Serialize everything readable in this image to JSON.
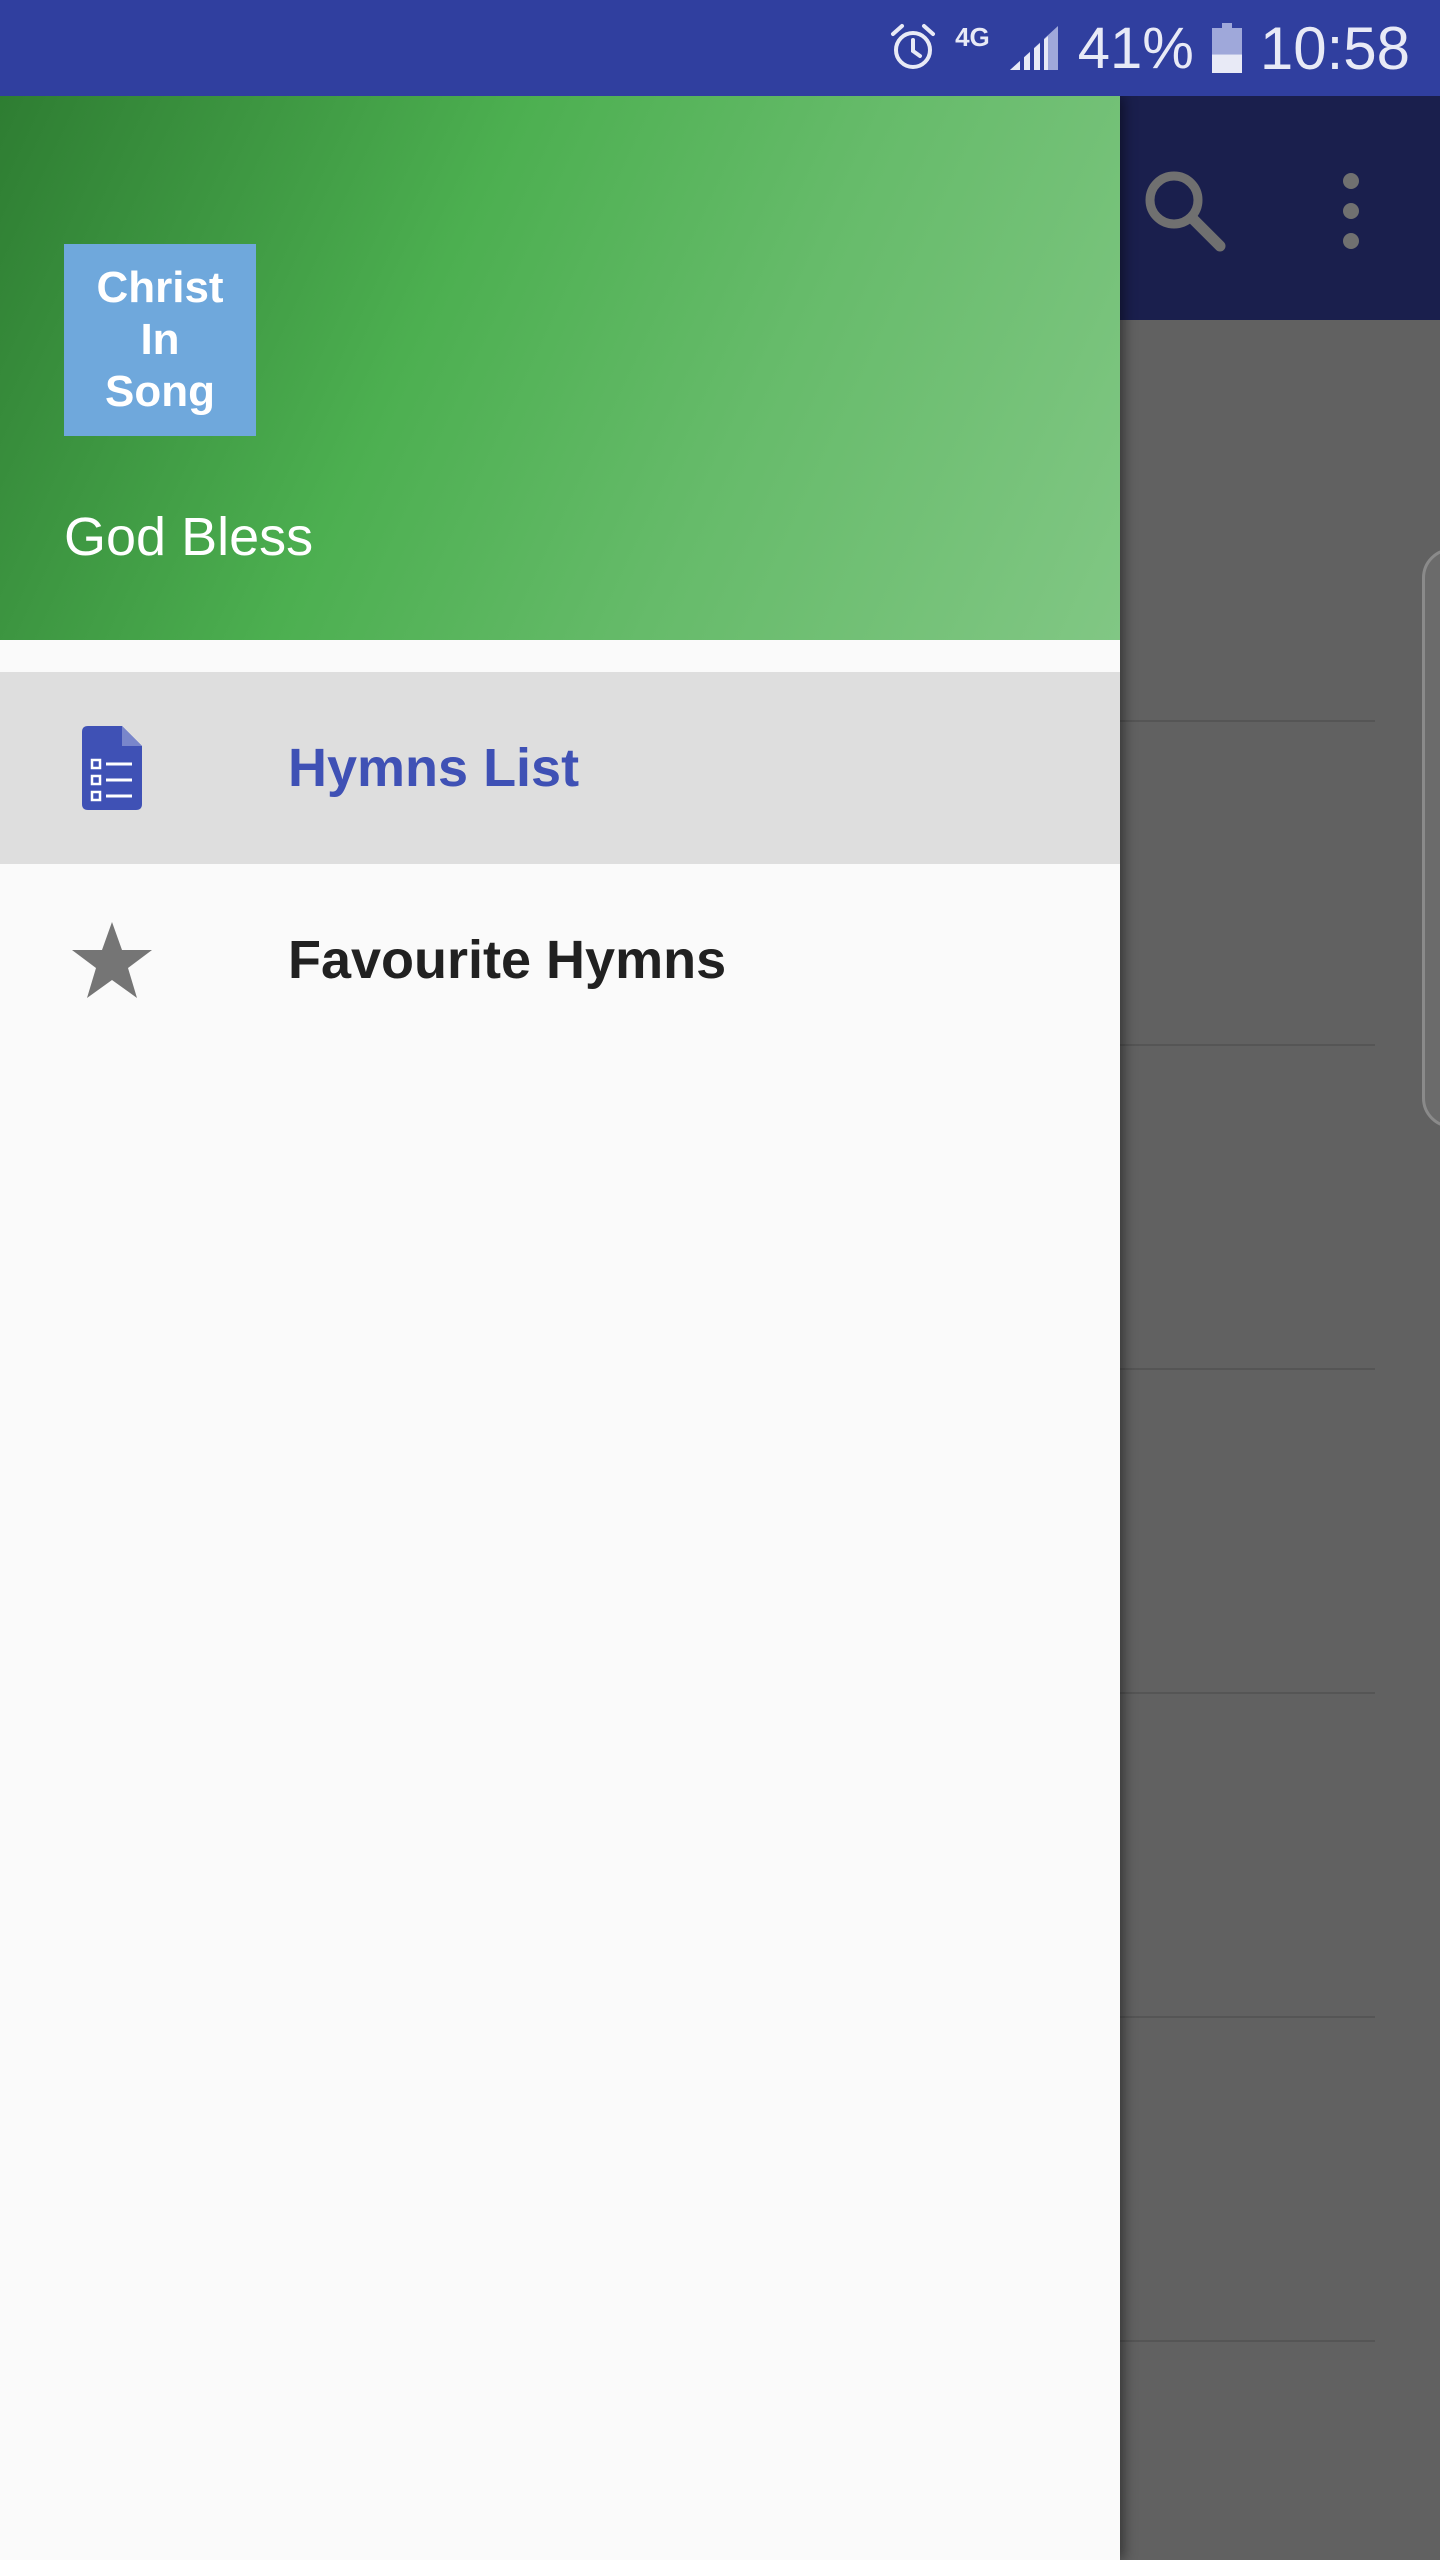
{
  "status_bar": {
    "network": "4G",
    "battery_percent": "41%",
    "battery_level": 0.41,
    "time": "10:58",
    "icons": [
      "alarm-icon",
      "signal-icon",
      "battery-icon"
    ]
  },
  "toolbar": {
    "icons": [
      "search-icon",
      "more-vert-icon"
    ]
  },
  "drawer": {
    "logo_lines": [
      "Christ",
      "In",
      "Song"
    ],
    "subtitle": "God Bless",
    "items": [
      {
        "label": "Hymns List",
        "icon": "document-list-icon",
        "selected": true
      },
      {
        "label": "Favourite Hymns",
        "icon": "star-icon",
        "selected": false
      }
    ]
  },
  "colors": {
    "status_bar": "#303f9f",
    "toolbar": "#1a1f4d",
    "accent": "#3f51b5",
    "header_green": "#4caf50",
    "logo_blue": "#6fa8dc",
    "selected_bg": "#dedede",
    "scrim": "#616161"
  }
}
